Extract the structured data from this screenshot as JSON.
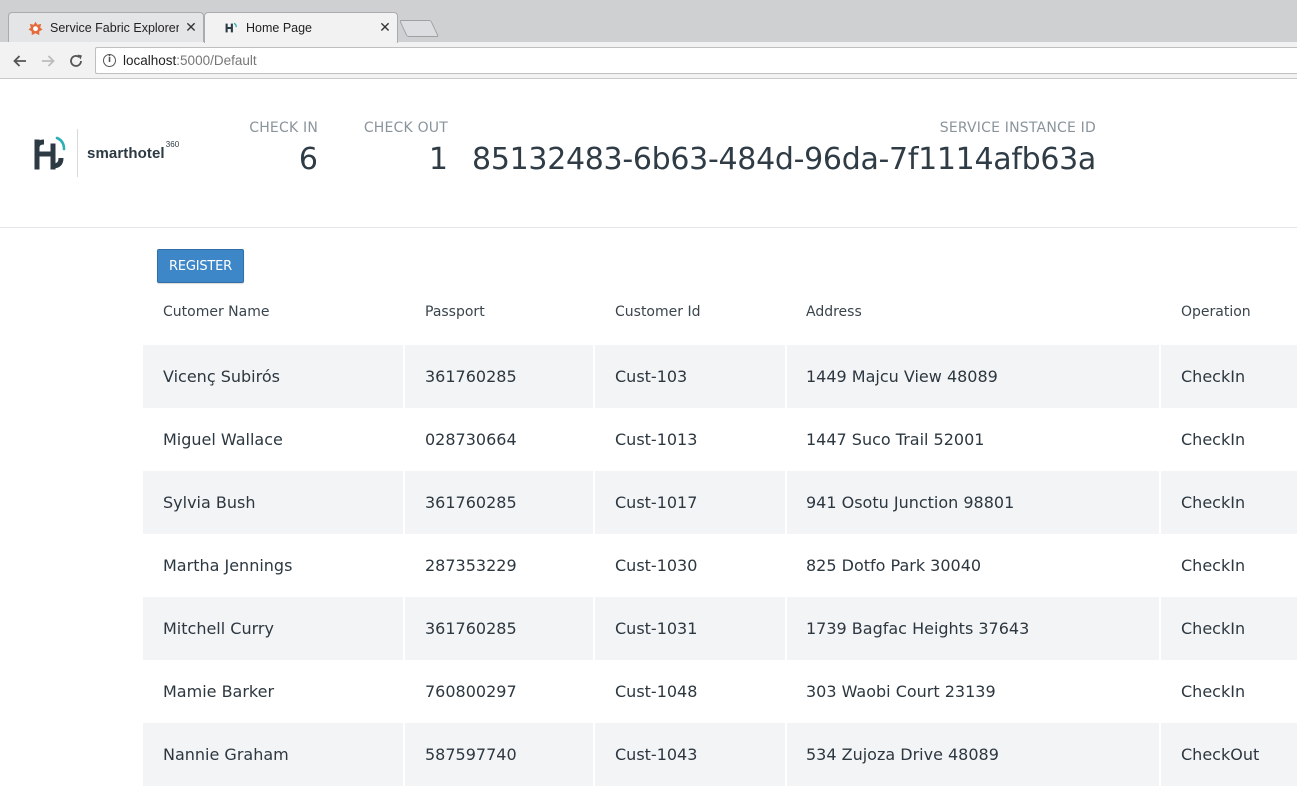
{
  "browser": {
    "tabs": [
      {
        "title": "Service Fabric Explorer",
        "active": false,
        "icon": "service-fabric-icon"
      },
      {
        "title": "Home Page",
        "active": true,
        "icon": "smarthotel-icon"
      }
    ],
    "address": {
      "host": "localhost",
      "path": ":5000/Default"
    }
  },
  "header": {
    "brand": "smarthotel",
    "brand_suffix": "360",
    "checkin": {
      "label": "CHECK IN",
      "value": "6"
    },
    "checkout": {
      "label": "CHECK OUT",
      "value": "1"
    },
    "service_instance": {
      "label": "SERVICE INSTANCE ID",
      "value": "85132483-6b63-484d-96da-7f1114afb63a"
    }
  },
  "register_label": "REGISTER",
  "table": {
    "columns": [
      "Cutomer Name",
      "Passport",
      "Customer Id",
      "Address",
      "Operation"
    ],
    "rows": [
      {
        "name": "Vicenç Subirós",
        "passport": "361760285",
        "id": "Cust-103",
        "address": "1449 Majcu View 48089",
        "operation": "CheckIn"
      },
      {
        "name": "Miguel Wallace",
        "passport": "028730664",
        "id": "Cust-1013",
        "address": "1447 Suco Trail 52001",
        "operation": "CheckIn"
      },
      {
        "name": "Sylvia Bush",
        "passport": "361760285",
        "id": "Cust-1017",
        "address": "941 Osotu Junction 98801",
        "operation": "CheckIn"
      },
      {
        "name": "Martha Jennings",
        "passport": "287353229",
        "id": "Cust-1030",
        "address": "825 Dotfo Park 30040",
        "operation": "CheckIn"
      },
      {
        "name": "Mitchell Curry",
        "passport": "361760285",
        "id": "Cust-1031",
        "address": "1739 Bagfac Heights 37643",
        "operation": "CheckIn"
      },
      {
        "name": "Mamie Barker",
        "passport": "760800297",
        "id": "Cust-1048",
        "address": "303 Waobi Court 23139",
        "operation": "CheckIn"
      },
      {
        "name": "Nannie Graham",
        "passport": "587597740",
        "id": "Cust-1043",
        "address": "534 Zujoza Drive 48089",
        "operation": "CheckOut"
      }
    ]
  },
  "colors": {
    "accent": "#3d87c8",
    "row_shade": "#f3f4f6",
    "brand_dark": "#2c3a44",
    "brand_teal": "#2bb0b8"
  }
}
